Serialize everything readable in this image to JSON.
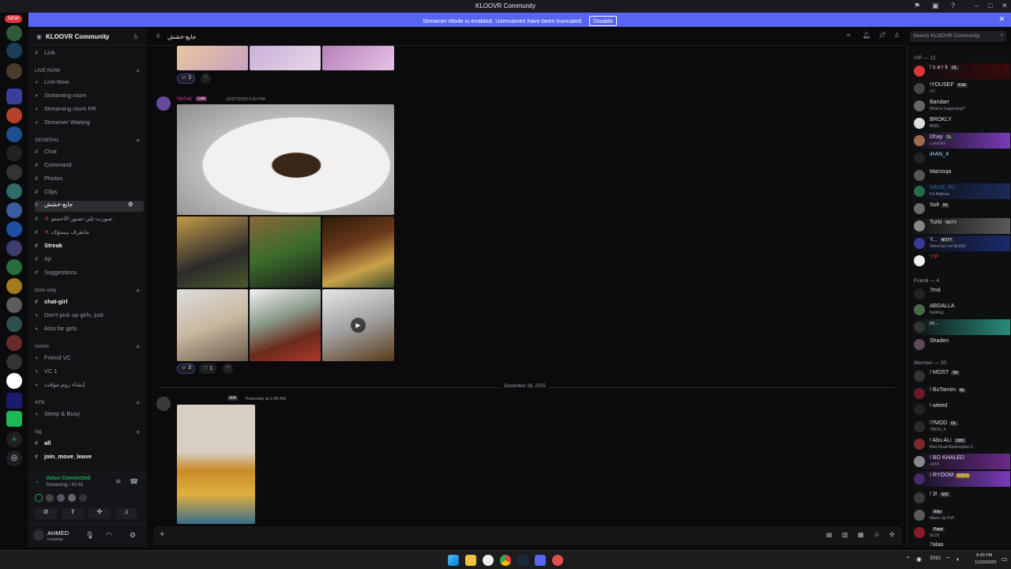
{
  "window": {
    "title": "KLOOVR Community"
  },
  "banner": {
    "text": "Streamer Mode is enabled. Usernames have been truncated.",
    "disable_label": "Disable"
  },
  "new_badge": "NEW",
  "server": {
    "name": "KLOOVR Community"
  },
  "channels": {
    "link": "Link",
    "cat_live_now": "LIVE NOW",
    "live_now": "Live-Now",
    "streaming_room": "Streaming room",
    "streaming_room_fr": "Streaming room FR",
    "streamer_waiting": "Streamer Waiting",
    "cat_general": "GENERAL",
    "chat": "Chat",
    "command": "Command",
    "photos": "Photos",
    "clips": "Clips",
    "selected": "جايع-خشش",
    "arabic1": "صورت-تلي-تصور-الاحمتم",
    "arabic2": "مابعرف يبسؤف",
    "streak": "Streak",
    "ajr": "Ajr",
    "suggestions": "Suggestions",
    "cat_girls": "Girls only",
    "chat_girl": "chat-girl",
    "dont_pick": "Don't pick up girls, just",
    "also_girls": "Also for girls",
    "cat_rooms": "rooms",
    "friend_vc": "Friend VC",
    "vc1": "VC 1",
    "arabic_vc": "إنشاء روم مؤقت",
    "cat_afk": "AFK",
    "sleep_busy": "Sleep & Busy",
    "cat_log": "log",
    "all": "all",
    "join_move_leave": "join_move_leave"
  },
  "voice": {
    "status": "Voice Connected",
    "sub": "Streaming / 43 63"
  },
  "user": {
    "name": "AHMED",
    "status": "Invisible"
  },
  "chat_header": {
    "channel": "جايع-خشش",
    "search_placeholder": "Search KLOOVR Community"
  },
  "messages": {
    "reactions_top": {
      "count": "3"
    },
    "msg1": {
      "author": "Nehal",
      "tag": "cute",
      "time": "12/27/2025 2:52 PM",
      "react1": "3",
      "react2": "1"
    },
    "divider": "December 28, 2025",
    "msg2": {
      "tag": "506",
      "time": "Yesterday at 2:45 AM"
    }
  },
  "members": {
    "vip_header": "VIP — 12",
    "vip": [
      {
        "name": "! s a r k",
        "tag": "OL",
        "status": ""
      },
      {
        "name": "!YOUSEF",
        "tag": "KSA",
        "status": "1!!!"
      },
      {
        "name": "Bandarr",
        "tag": "",
        "status": "What is happening?!"
      },
      {
        "name": "BROKLY",
        "tag": "",
        "status": "BRKL"
      },
      {
        "name": "Dhay",
        "tag": "OL",
        "status": "LuneDev"
      },
      {
        "name": "iHAN_4",
        "tag": "",
        "status": ""
      },
      {
        "name": "Marzoqa",
        "tag": "",
        "status": ""
      },
      {
        "name": "SALM_00",
        "tag": "",
        "status": "I'm Batman"
      },
      {
        "name": "Solt",
        "tag": "RL",
        "status": ""
      },
      {
        "name": "Turki",
        "tag": "NOTY",
        "status": ""
      },
      {
        "name": "Y...",
        "tag": "NOTY",
        "status": "Silent but not BLIND"
      },
      {
        "name": "Y!P",
        "tag": "",
        "status": ""
      }
    ],
    "friend_header": "Friend — 4",
    "friends": [
      {
        "name": "7md",
        "status": ""
      },
      {
        "name": "ABDALLA",
        "status": "Nothing."
      },
      {
        "name": "m...",
        "status": ""
      },
      {
        "name": "Shaden",
        "status": ""
      }
    ],
    "member_header": "Member — 30",
    "member": [
      {
        "name": "! MOST",
        "tag": "99r",
        "status": ""
      },
      {
        "name": "! BuTamim",
        "tag": "8p",
        "status": ""
      },
      {
        "name": "! wleed",
        "tag": "",
        "status": ""
      },
      {
        "name": "!7MOD",
        "tag": "OL",
        "status": "7MOD_4"
      },
      {
        "name": "! Abu ALi",
        "tag": "1980",
        "status": "Red Dead Redemption 2"
      },
      {
        "name": "! BO KHALED",
        "tag": "",
        "status": "+974"
      },
      {
        "name": "! RYOOM",
        "tag": "GOLD",
        "status": ""
      },
      {
        "name": "! 3!",
        "tag": "S02",
        "status": ""
      },
      {
        "name": "",
        "tag": "Riko",
        "status": "Warm Up PvP"
      },
      {
        "name": "",
        "tag": "Paud",
        "status": "9LO3"
      },
      {
        "name": "7alaa",
        "tag": "",
        "status": ""
      }
    ]
  },
  "taskbar": {
    "lang": "ENG",
    "time": "9:40 PM",
    "date": "12/29/2025"
  },
  "colors": {
    "accent": "#5865f2",
    "online": "#23a55a",
    "dnd": "#f23f43",
    "bg": "#0b0b0d"
  }
}
